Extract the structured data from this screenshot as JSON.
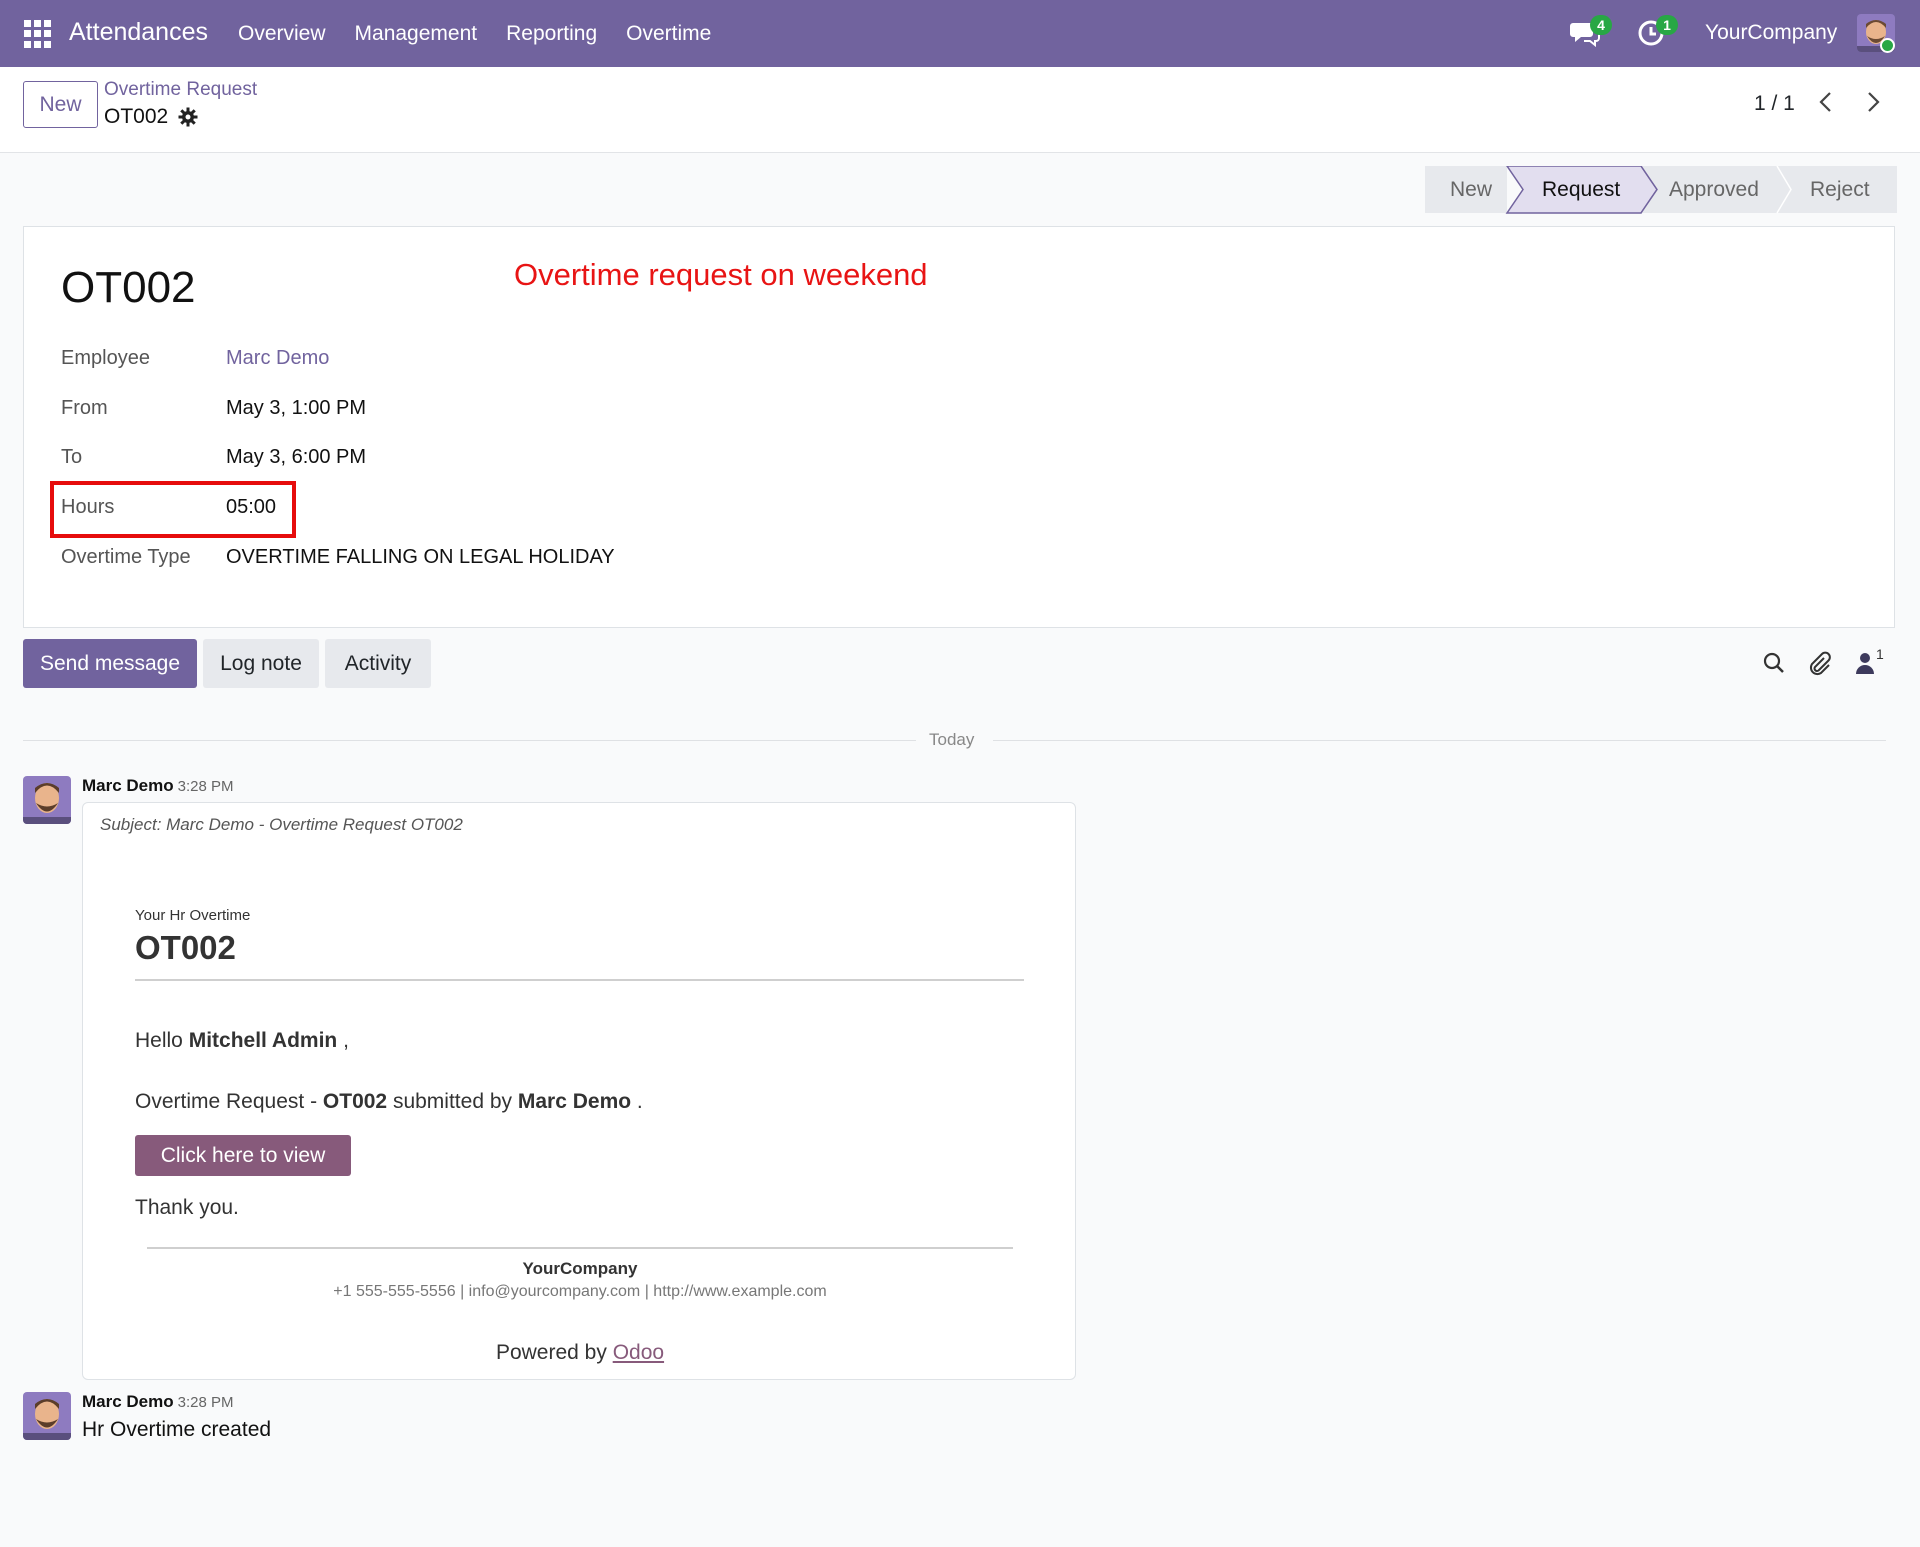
{
  "navbar": {
    "app_name": "Attendances",
    "menu": [
      "Overview",
      "Management",
      "Reporting",
      "Overtime"
    ],
    "messages_count": "4",
    "activities_count": "1",
    "company": "YourCompany"
  },
  "control": {
    "new_label": "New",
    "breadcrumb_parent": "Overtime Request",
    "breadcrumb_current": "OT002",
    "pager": "1 / 1"
  },
  "statusbar": {
    "stages": [
      "New",
      "Request",
      "Approved",
      "Reject"
    ],
    "active": "Request"
  },
  "form": {
    "title": "OT002",
    "annotation": "Overtime request on weekend",
    "fields": [
      {
        "label": "Employee",
        "value": "Marc Demo"
      },
      {
        "label": "From",
        "value": "May 3, 1:00 PM"
      },
      {
        "label": "To",
        "value": "May 3, 6:00 PM"
      },
      {
        "label": "Hours",
        "value": "05:00"
      },
      {
        "label": "Overtime Type",
        "value": "OVERTIME FALLING ON LEGAL HOLIDAY"
      }
    ]
  },
  "chatter": {
    "send_label": "Send message",
    "log_label": "Log note",
    "activity_label": "Activity",
    "followers_count": "1",
    "divider_label": "Today",
    "messages": [
      {
        "author": "Marc Demo",
        "time": "3:28 PM",
        "subject": "Subject: Marc Demo - Overtime Request OT002",
        "kicker": "Your Hr Overtime",
        "title": "OT002",
        "greeting_prefix": "Hello",
        "greeting_name": "Mitchell Admin",
        "greeting_suffix": ",",
        "body_prefix": "Overtime Request -",
        "body_ref": "OT002",
        "body_mid": "submitted by",
        "body_author": "Marc Demo",
        "body_suffix": ".",
        "cta_label": "Click here to view",
        "thanks": "Thank you.",
        "footer_company": "YourCompany",
        "footer_contact": "+1 555-555-5556 | info@yourcompany.com | http://www.example.com",
        "powered_prefix": "Powered by",
        "powered_link": "Odoo"
      },
      {
        "author": "Marc Demo",
        "time": "3:28 PM",
        "body": "Hr Overtime created"
      }
    ]
  },
  "colors": {
    "brand": "#71639e",
    "mail_button": "#875a7b",
    "annotation": "#e81414",
    "badge": "#28a745"
  }
}
